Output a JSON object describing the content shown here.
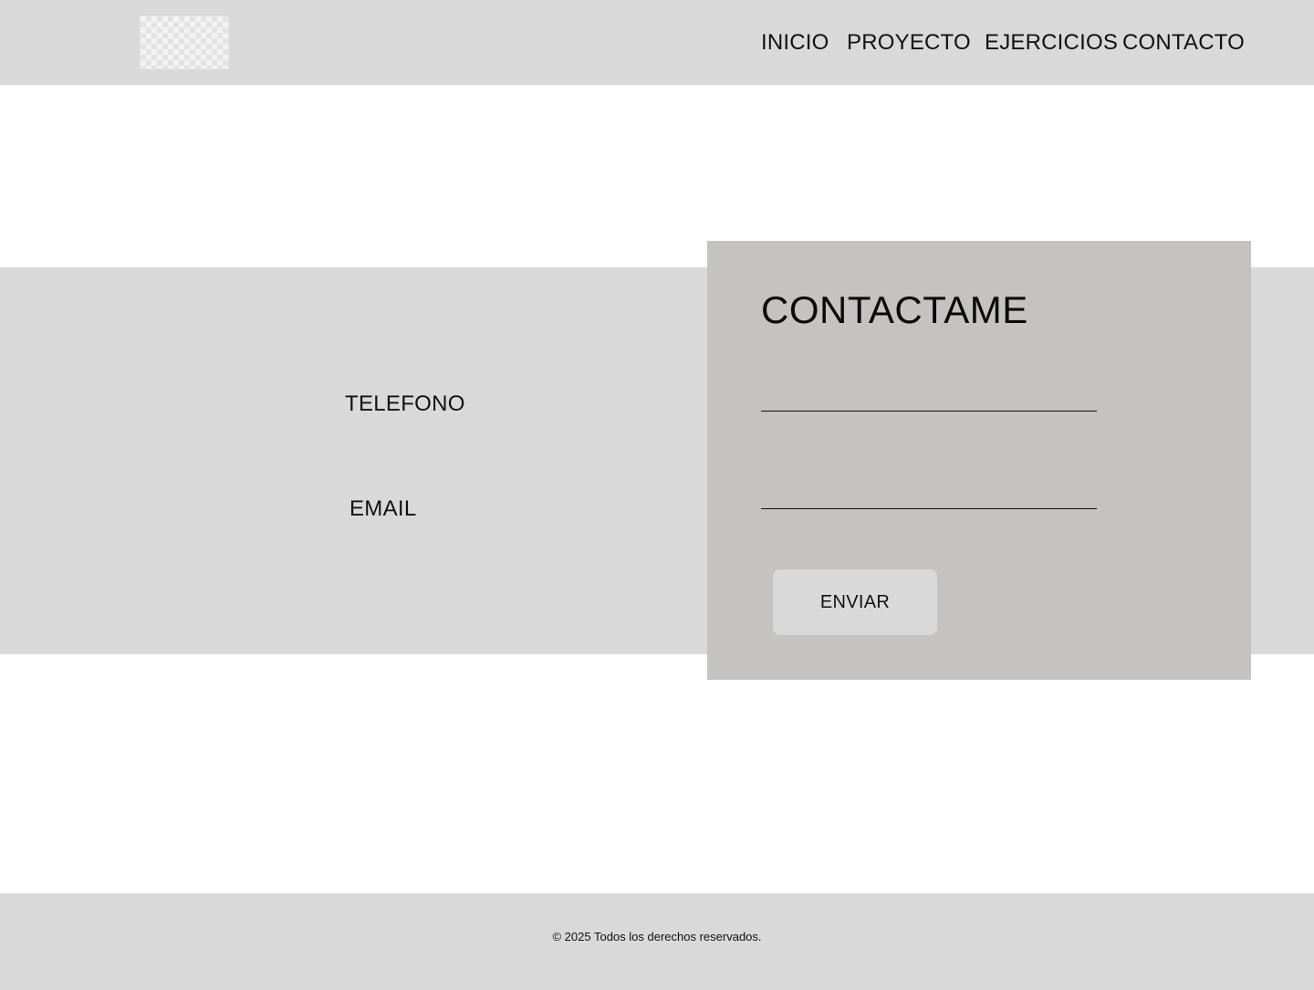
{
  "header": {
    "logo_name": "image-placeholder",
    "nav": {
      "inicio": "INICIO",
      "proyecto": "PROYECTO",
      "ejercicios": "EJERCICIOS",
      "contacto": "CONTACTO"
    }
  },
  "contact_info": {
    "telefono_label": "TELEFONO",
    "email_label": "EMAIL"
  },
  "form": {
    "title": "CONTACTAME",
    "field_1": {
      "value": "",
      "placeholder": ""
    },
    "field_2": {
      "value": "",
      "placeholder": ""
    },
    "submit_label": "ENVIAR"
  },
  "footer": {
    "copyright": "© 2025 Todos los derechos reservados."
  },
  "colors": {
    "header_bg": "#d9d9d9",
    "band_bg": "#d9d9d9",
    "card_bg": "#c4c3c1",
    "button_bg": "#d9d9d9",
    "text": "#000000"
  }
}
